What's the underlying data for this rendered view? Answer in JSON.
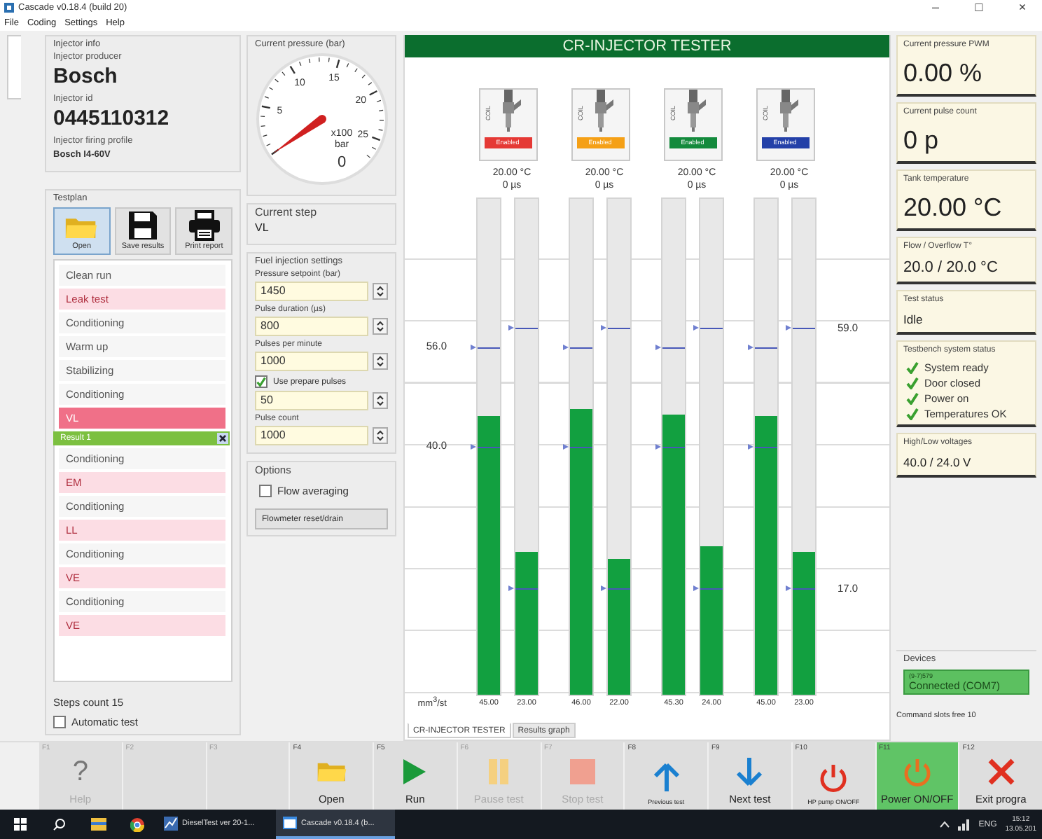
{
  "window": {
    "title": "Cascade v0.18.4 (build 20)",
    "controls": [
      "–",
      "□",
      "×"
    ]
  },
  "menu": [
    "File",
    "Coding",
    "Settings",
    "Help"
  ],
  "injector_info": {
    "title": "Injector info",
    "fields": [
      {
        "label": "Injector producer",
        "value": "Bosch",
        "kind": "large"
      },
      {
        "label": "Injector id",
        "value": "0445110312",
        "kind": "large"
      },
      {
        "label": "Injector firing profile",
        "value": "Bosch I4-60V",
        "kind": "small"
      }
    ]
  },
  "testplan": {
    "title": "Testplan",
    "buttons": [
      {
        "label": "Open",
        "kind": "folder",
        "selected": true
      },
      {
        "label": "Save results",
        "kind": "disk",
        "selected": false
      },
      {
        "label": "Print report",
        "kind": "printer",
        "selected": false
      }
    ],
    "steps": [
      {
        "label": "Clean run",
        "kind": "plain",
        "selected": false
      },
      {
        "label": "Leak test",
        "kind": "test",
        "selected": false
      },
      {
        "label": "Conditioning",
        "kind": "plain",
        "selected": false
      },
      {
        "label": "Warm up",
        "kind": "plain",
        "selected": false
      },
      {
        "label": "Stabilizing",
        "kind": "plain",
        "selected": false
      },
      {
        "label": "Conditioning",
        "kind": "plain",
        "selected": false
      },
      {
        "label": "VL",
        "kind": "test",
        "selected": true
      },
      {
        "label": "Result 1",
        "kind": "result",
        "selected": false
      },
      {
        "label": "Conditioning",
        "kind": "plain",
        "selected": false
      },
      {
        "label": "EM",
        "kind": "test",
        "selected": false
      },
      {
        "label": "Conditioning",
        "kind": "plain",
        "selected": false
      },
      {
        "label": "LL",
        "kind": "test",
        "selected": false
      },
      {
        "label": "Conditioning",
        "kind": "plain",
        "selected": false
      },
      {
        "label": "VE",
        "kind": "test",
        "selected": false
      },
      {
        "label": "Conditioning",
        "kind": "plain",
        "selected": false
      },
      {
        "label": "VE",
        "kind": "test",
        "selected": false
      }
    ],
    "steps_count": "Steps count 15",
    "automatic": {
      "label": "Automatic test",
      "checked": false
    }
  },
  "pressure_gauge": {
    "title": "Current pressure (bar)",
    "ticks": [
      "5",
      "10",
      "15",
      "20",
      "25"
    ],
    "multiplier": "x100",
    "unit": "bar",
    "reading": "0"
  },
  "current_step": {
    "title": "Current step",
    "value": "VL"
  },
  "fuel_settings": {
    "title": "Fuel injection settings",
    "fields": [
      {
        "kind": "spin",
        "label": "Pressure setpoint (bar)",
        "value": "1450"
      },
      {
        "kind": "spin",
        "label": "Pulse duration (µs)",
        "value": "800"
      },
      {
        "kind": "spin",
        "label": "Pulses per minute",
        "value": "1000"
      },
      {
        "kind": "checkbox",
        "label": "Use prepare pulses",
        "checked": true,
        "value": "50"
      },
      {
        "kind": "spin",
        "label": "Pulse count",
        "value": "1000"
      }
    ]
  },
  "options": {
    "title": "Options",
    "flow_averaging": {
      "label": "Flow averaging",
      "checked": false
    },
    "button": "Flowmeter reset/drain"
  },
  "tester": {
    "title": "CR-INJECTOR TESTER",
    "injectors": [
      {
        "coil": "COIL",
        "status": "Enabled",
        "color": "#e53935",
        "temperature": "20.00 °C",
        "pulse": "0 µs",
        "bars": [
          {
            "level": 0.5625,
            "value": "45.00"
          },
          {
            "level": 0.2875,
            "value": "23.00"
          }
        ]
      },
      {
        "coil": "COIL",
        "status": "Enabled",
        "color": "#f5a016",
        "temperature": "20.00 °C",
        "pulse": "0 µs",
        "bars": [
          {
            "level": 0.575,
            "value": "46.00"
          },
          {
            "level": 0.275,
            "value": "22.00"
          }
        ]
      },
      {
        "coil": "COIL",
        "status": "Enabled",
        "color": "#138a3c",
        "temperature": "20.00 °C",
        "pulse": "0 µs",
        "bars": [
          {
            "level": 0.566,
            "value": "45.30"
          },
          {
            "level": 0.3,
            "value": "24.00"
          }
        ]
      },
      {
        "coil": "COIL",
        "status": "Enabled",
        "color": "#2340a8",
        "temperature": "20.00 °C",
        "pulse": "0 µs",
        "bars": [
          {
            "level": 0.5625,
            "value": "45.00"
          },
          {
            "level": 0.2875,
            "value": "23.00"
          }
        ]
      }
    ],
    "limits_left": [
      {
        "label": "56.0",
        "level": 0.7
      },
      {
        "label": "40.0",
        "level": 0.5
      }
    ],
    "limits_right": [
      {
        "label": "59.0",
        "level": 0.7375
      },
      {
        "label": "17.0",
        "level": 0.2125
      }
    ],
    "unit": "mm$^{3}$/st",
    "tabs": [
      {
        "label": "CR-INJECTOR TESTER",
        "selected": true
      },
      {
        "label": "Results graph",
        "selected": false
      }
    ]
  },
  "status_cards": [
    {
      "kind": "large",
      "label": "Current pressure PWM",
      "value": "0.00 %"
    },
    {
      "kind": "large",
      "label": "Current pulse count",
      "value": "0 p"
    },
    {
      "kind": "large",
      "label": "Tank temperature",
      "value": "20.00 °C"
    },
    {
      "kind": "medium",
      "label": "Flow / Overflow T°",
      "value": "20.0 / 20.0 °C"
    },
    {
      "kind": "small",
      "label": "Test status",
      "value": "Idle"
    },
    {
      "kind": "checklist",
      "label": "Testbench system status",
      "items": [
        {
          "label": "System ready",
          "checked": true
        },
        {
          "label": "Door closed",
          "checked": true
        },
        {
          "label": "Power on",
          "checked": true
        },
        {
          "label": "Temperatures OK",
          "checked": true
        }
      ]
    },
    {
      "kind": "small",
      "label": "High/Low voltages",
      "value": "40.0 / 24.0 V"
    }
  ],
  "devices": {
    "title": "Devices",
    "device": "(9-7)579",
    "state": "Connected (COM7)",
    "connected": true,
    "slots": "Command slots free 10"
  },
  "fkeys": [
    {
      "key": "F1",
      "label": "Help",
      "kind": "help",
      "symbol": "?",
      "disabled": true,
      "active": false
    },
    {
      "key": "F2",
      "disabled": true,
      "active": false
    },
    {
      "key": "F3",
      "disabled": true,
      "active": false
    },
    {
      "key": "F4",
      "label": "Open",
      "kind": "folder",
      "disabled": false,
      "active": false
    },
    {
      "key": "F5",
      "label": "Run",
      "kind": "play",
      "disabled": false,
      "active": false
    },
    {
      "key": "F6",
      "label": "Pause test",
      "kind": "pause",
      "disabled": true,
      "active": false
    },
    {
      "key": "F7",
      "label": "Stop test",
      "kind": "stop",
      "disabled": true,
      "active": false
    },
    {
      "key": "F8",
      "label": "Previous test",
      "kind": "up",
      "disabled": false,
      "active": false
    },
    {
      "key": "F9",
      "label": "Next test",
      "kind": "down",
      "disabled": false,
      "active": false
    },
    {
      "key": "F10",
      "label": "HP pump ON/OFF",
      "kind": "power",
      "disabled": false,
      "active": false
    },
    {
      "key": "F11",
      "label": "Power ON/OFF",
      "kind": "power",
      "disabled": false,
      "active": true
    },
    {
      "key": "F12",
      "label": "Exit progra",
      "kind": "x",
      "disabled": false,
      "active": false
    }
  ],
  "taskbar": {
    "apps": [
      {
        "label": "DieselTest ver 20-1...",
        "selected": false
      },
      {
        "label": "Cascade v0.18.4 (b...",
        "selected": true
      }
    ],
    "tray": {
      "language": "ENG",
      "time": "15:12",
      "date": "13.05.201"
    }
  }
}
